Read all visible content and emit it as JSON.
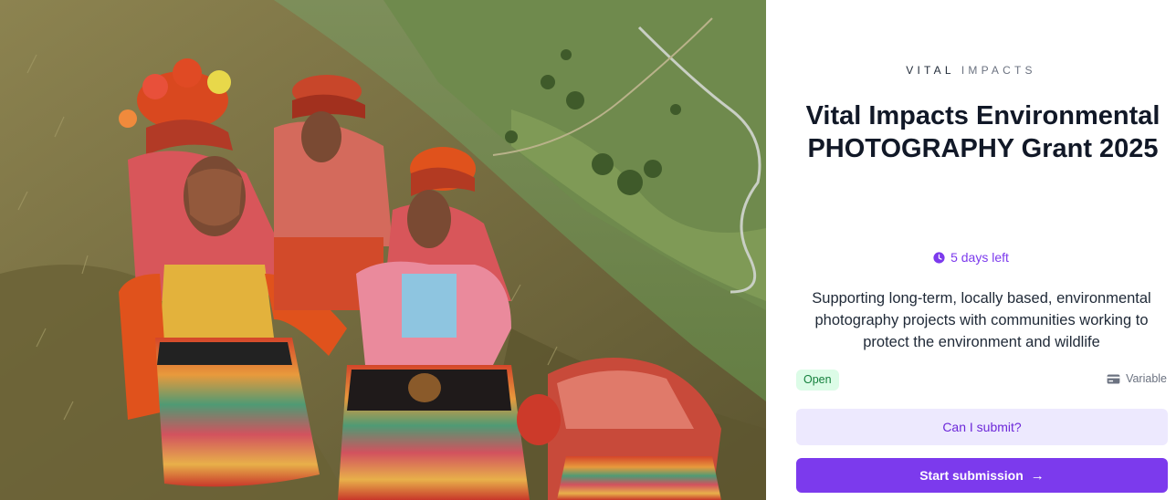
{
  "hero_image": {
    "alt": "",
    "palette": {
      "hillside": "#7a7447",
      "valley": "#6f8a4d",
      "river": "#c9cfc4",
      "red_textile": "#d9481f",
      "pink_textile": "#e07a7a",
      "yellow_vest": "#e0b13c",
      "skirt_multi": "#c8542c"
    }
  },
  "organization": {
    "logo_text_strong": "VITAL",
    "logo_text_light": "IMPACTS"
  },
  "grant": {
    "title": "Vital Impacts Environmental PHOTOGRAPHY Grant 2025",
    "deadline_text": "5 days left",
    "deadline_icon": "clock-icon",
    "description": "Supporting long-term, locally based, environmental photography projects with communities working to protect the environment and wildlife",
    "status_badge": "Open",
    "fee_label": "Variable",
    "fee_icon": "credit-card-icon"
  },
  "actions": {
    "secondary_label": "Can I submit?",
    "primary_label": "Start submission",
    "primary_icon": "arrow-right-icon"
  },
  "colors": {
    "accent": "#7c3aed",
    "accent_soft": "#ede9fe",
    "open_bg": "#dcfce7",
    "open_text": "#15803d"
  }
}
